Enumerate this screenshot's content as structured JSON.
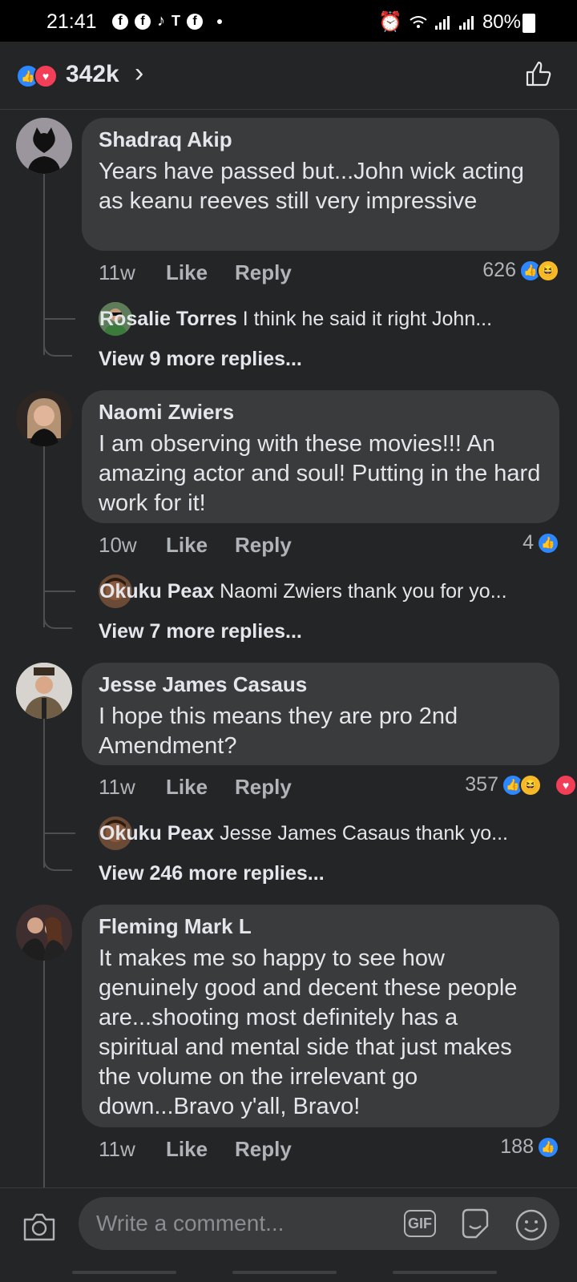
{
  "status_bar": {
    "time": "21:41",
    "battery": "80%",
    "app_icons": [
      "facebook",
      "facebook",
      "tiktok",
      "teams",
      "facebook"
    ]
  },
  "header": {
    "reaction_count": "342k",
    "chevron": "›"
  },
  "comments": [
    {
      "name": "Shadraq Akip",
      "text": "Years have passed but...John wick acting as keanu reeves still very impressive",
      "time": "11w",
      "like_label": "Like",
      "reply_label": "Reply",
      "reaction_count": "626",
      "reactions": [
        "like",
        "haha"
      ],
      "reply_preview": {
        "name": "Rosalie Torres",
        "text": "I think he said it right John..."
      },
      "more_replies": "View 9 more replies..."
    },
    {
      "name": "Naomi Zwiers",
      "text": "I am observing with these movies!!! An amazing actor and soul! Putting in the hard work for it!",
      "time": "10w",
      "like_label": "Like",
      "reply_label": "Reply",
      "reaction_count": "4",
      "reactions": [
        "like"
      ],
      "reply_preview": {
        "name": "Okuku Peax",
        "text": "Naomi Zwiers thank you for yo..."
      },
      "more_replies": "View 7 more replies..."
    },
    {
      "name": "Jesse James Casaus",
      "text": "I hope this means they are pro 2nd Amendment?",
      "time": "11w",
      "like_label": "Like",
      "reply_label": "Reply",
      "reaction_count": "357",
      "reactions": [
        "like",
        "haha",
        "love"
      ],
      "reply_preview": {
        "name": "Okuku Peax",
        "text": "Jesse James Casaus thank yo..."
      },
      "more_replies": "View 246 more replies..."
    },
    {
      "name": "Fleming Mark L",
      "text": "It makes me so happy to see how genuinely good and decent these people are...shooting most definitely has a spiritual and mental side that just makes the volume on the irrelevant go down...Bravo y'all, Bravo!",
      "time": "11w",
      "like_label": "Like",
      "reply_label": "Reply",
      "reaction_count": "188",
      "reactions": [
        "like"
      ]
    }
  ],
  "composer": {
    "placeholder": "Write a comment...",
    "gif_label": "GIF"
  },
  "colors": {
    "background": "#242526",
    "bubble": "#3a3b3c",
    "like_blue": "#2d88ff",
    "love_red": "#f33e58",
    "haha_yellow": "#f7b928"
  }
}
